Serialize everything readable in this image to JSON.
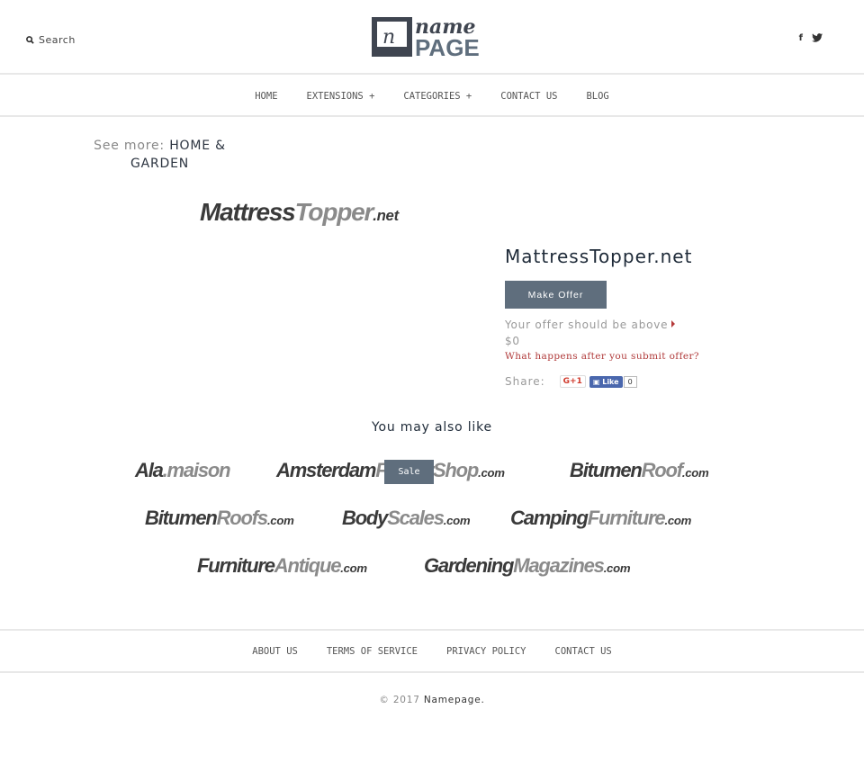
{
  "header": {
    "search_label": "Search",
    "logo_text": "name PAGE",
    "social": [
      "facebook-icon",
      "twitter-icon"
    ]
  },
  "nav": [
    "HOME",
    "EXTENSIONS +",
    "CATEGORIES +",
    "CONTACT US",
    "BLOG"
  ],
  "see_more": {
    "label": "See more:",
    "category": "HOME & GARDEN"
  },
  "product": {
    "logo": {
      "a": "Mattress",
      "b": "Topper",
      "c": ".net"
    },
    "title": "MattressTopper.net",
    "make_offer": "Make Offer",
    "offer_note": "Your offer should be above $0",
    "what_happens": "What happens after you submit offer?",
    "share_label": "Share:",
    "gplus": "G+1",
    "fb_like": "Like",
    "fb_count": "0"
  },
  "also_like": {
    "title": "You may also like",
    "sale_badge": "Sale",
    "items": [
      {
        "a": "Ala",
        "b": ".maison",
        "c": ""
      },
      {
        "a": "Amsterdam",
        "b": "FlowerShop",
        "c": ".com"
      },
      {
        "a": "Bitumen",
        "b": "Roof",
        "c": ".com"
      },
      {
        "a": "Bitumen",
        "b": "Roofs",
        "c": ".com"
      },
      {
        "a": "Body",
        "b": "Scales",
        "c": ".com"
      },
      {
        "a": "Camping",
        "b": "Furniture",
        "c": ".com"
      },
      {
        "a": "Furniture",
        "b": "Antique",
        "c": ".com"
      },
      {
        "a": "Gardening",
        "b": "Magazines",
        "c": ".com"
      }
    ]
  },
  "footer": {
    "links": [
      "ABOUT US",
      "TERMS OF SERVICE",
      "PRIVACY POLICY",
      "CONTACT US"
    ],
    "copyright": "© 2017",
    "brand": "Namepage."
  }
}
